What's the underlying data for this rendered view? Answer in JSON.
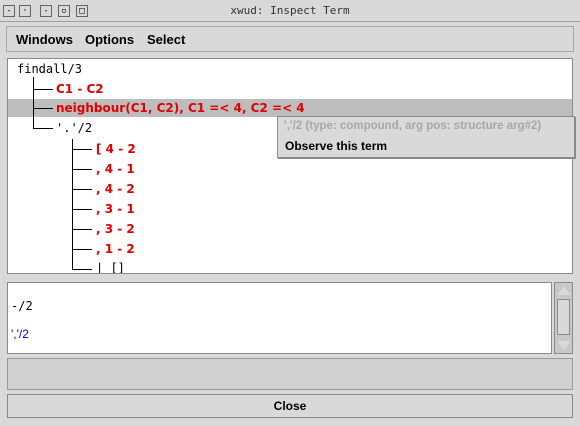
{
  "window": {
    "title": "xwud: Inspect Term",
    "buttons": [
      "-",
      "▪",
      "▭",
      "□"
    ]
  },
  "menu": {
    "windows": "Windows",
    "options": "Options",
    "select": "Select"
  },
  "tree": {
    "root": "findall/3",
    "child1": "C1 - C2",
    "child2": "neighbour(C1, C2), C1 =< 4, C2 =< 4",
    "child3": "'.'/2",
    "list_items": [
      "[ 4 - 2",
      ", 4 - 1",
      ", 4 - 2",
      ", 3 - 1",
      ", 3 - 2",
      ", 1 - 2",
      "| []"
    ]
  },
  "popup": {
    "header": "','/2 (type: compound, arg pos: structure arg#2)",
    "action": "Observe this term"
  },
  "output": {
    "line1": "-/2",
    "line2": "','/2"
  },
  "status": {
    "text": ""
  },
  "close_label": "Close"
}
